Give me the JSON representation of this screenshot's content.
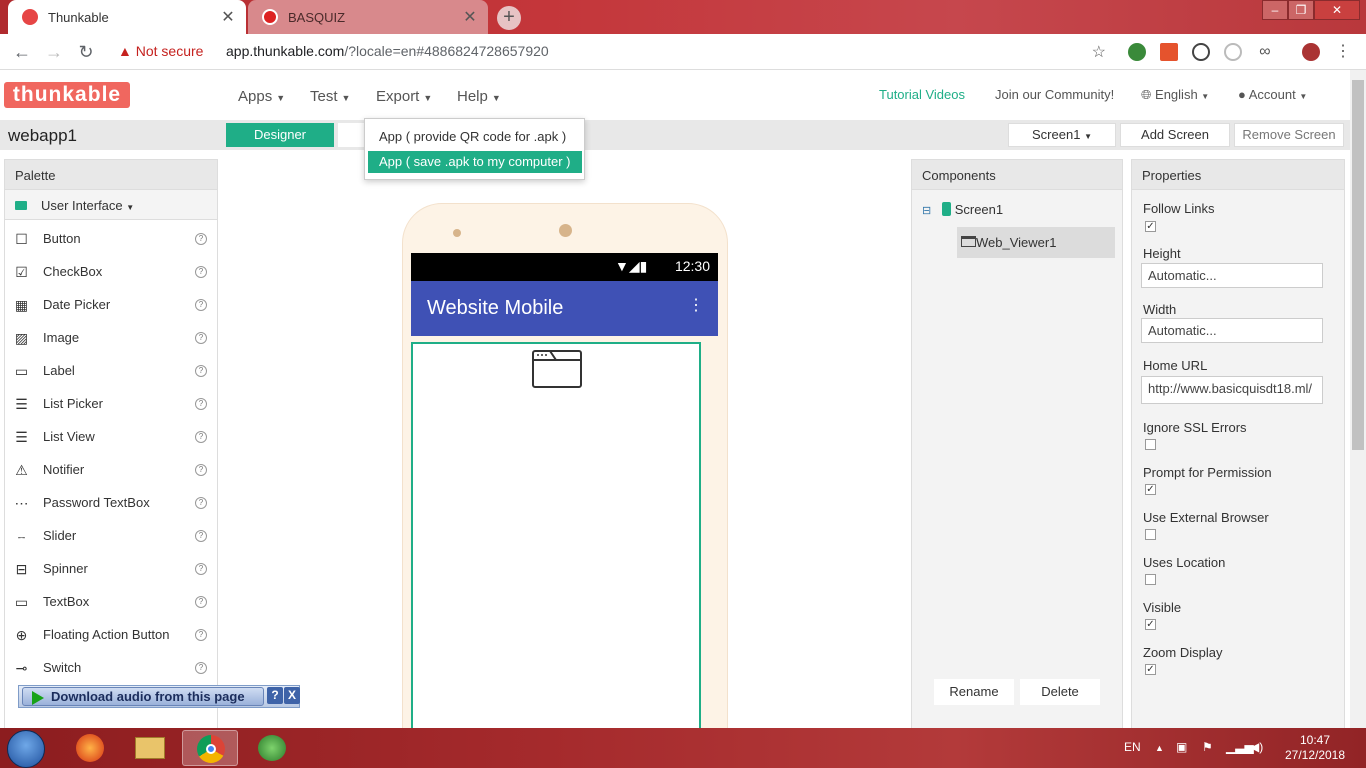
{
  "browser": {
    "tabs": [
      {
        "title": "Thunkable",
        "active": true
      },
      {
        "title": "BASQUIZ",
        "active": false
      }
    ],
    "security_label": "Not secure",
    "url_host": "app.thunkable.com",
    "url_rest": "/?locale=en#4886824728657920"
  },
  "app": {
    "logo": "thunkable",
    "menu": [
      "Apps",
      "Test",
      "Export",
      "Help"
    ],
    "tutorial_link": "Tutorial Videos",
    "community_link": "Join our Community!",
    "language": "English",
    "account": "Account",
    "project_name": "webapp1",
    "designer_tab": "Designer",
    "screen_select": "Screen1",
    "add_screen": "Add Screen",
    "remove_screen": "Remove Screen",
    "accent_color": "#1fae87"
  },
  "export_menu": {
    "items": [
      "App ( provide QR code for .apk )",
      "App ( save .apk to my computer )"
    ],
    "selected_index": 1
  },
  "palette": {
    "title": "Palette",
    "category": "User Interface",
    "items": [
      {
        "label": "Button",
        "icon": "square-outline-icon"
      },
      {
        "label": "CheckBox",
        "icon": "checkbox-icon"
      },
      {
        "label": "Date Picker",
        "icon": "calendar-icon"
      },
      {
        "label": "Image",
        "icon": "image-icon"
      },
      {
        "label": "Label",
        "icon": "label-icon"
      },
      {
        "label": "List Picker",
        "icon": "list-picker-icon"
      },
      {
        "label": "List View",
        "icon": "list-icon"
      },
      {
        "label": "Notifier",
        "icon": "warning-icon"
      },
      {
        "label": "Password TextBox",
        "icon": "password-icon"
      },
      {
        "label": "Slider",
        "icon": "slider-icon"
      },
      {
        "label": "Spinner",
        "icon": "spinner-icon"
      },
      {
        "label": "TextBox",
        "icon": "textbox-icon"
      },
      {
        "label": "Floating Action Button",
        "icon": "plus-circle-icon"
      },
      {
        "label": "Switch",
        "icon": "switch-icon"
      }
    ]
  },
  "download_bar": {
    "label": "Download audio from this page",
    "help": "?",
    "close": "X"
  },
  "phone": {
    "time": "12:30",
    "title": "Website Mobile",
    "appbar_color": "#3f51b5"
  },
  "components": {
    "title": "Components",
    "screen": "Screen1",
    "child": "Web_Viewer1",
    "rename": "Rename",
    "delete": "Delete"
  },
  "properties": {
    "title": "Properties",
    "follow_links": {
      "label": "Follow Links",
      "checked": true
    },
    "height": {
      "label": "Height",
      "value": "Automatic..."
    },
    "width": {
      "label": "Width",
      "value": "Automatic..."
    },
    "home_url": {
      "label": "Home URL",
      "value": "http://www.basicquisdt18.ml/"
    },
    "ignore_ssl": {
      "label": "Ignore SSL Errors",
      "checked": false
    },
    "prompt_permission": {
      "label": "Prompt for Permission",
      "checked": true
    },
    "external_browser": {
      "label": "Use External Browser",
      "checked": false
    },
    "uses_location": {
      "label": "Uses Location",
      "checked": false
    },
    "visible": {
      "label": "Visible",
      "checked": true
    },
    "zoom_display": {
      "label": "Zoom Display",
      "checked": true
    }
  },
  "taskbar": {
    "lang": "EN",
    "time": "10:47",
    "date": "27/12/2018"
  }
}
